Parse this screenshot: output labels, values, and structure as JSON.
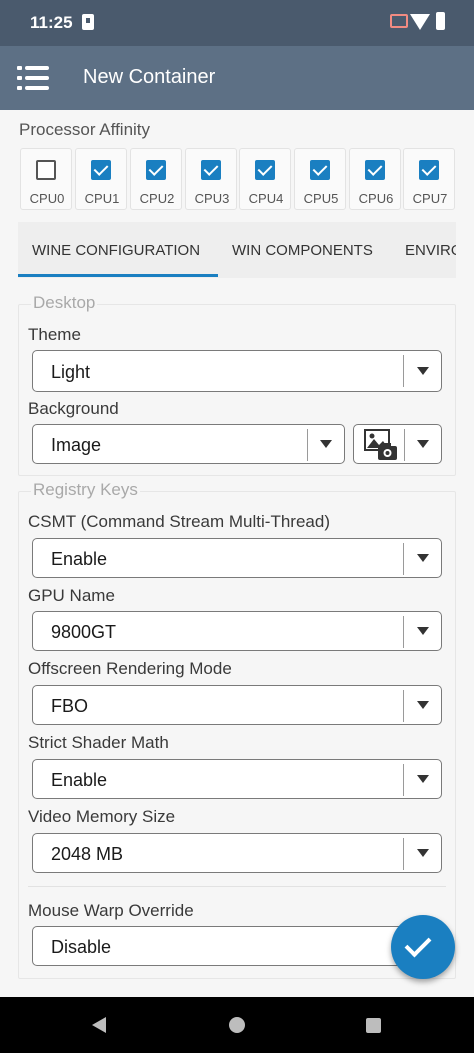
{
  "status_bar": {
    "time": "11:25"
  },
  "app_bar": {
    "title": "New Container"
  },
  "processor_affinity": {
    "label": "Processor Affinity",
    "cpus": [
      {
        "label": "CPU0",
        "checked": false
      },
      {
        "label": "CPU1",
        "checked": true
      },
      {
        "label": "CPU2",
        "checked": true
      },
      {
        "label": "CPU3",
        "checked": true
      },
      {
        "label": "CPU4",
        "checked": true
      },
      {
        "label": "CPU5",
        "checked": true
      },
      {
        "label": "CPU6",
        "checked": true
      },
      {
        "label": "CPU7",
        "checked": true
      }
    ]
  },
  "tabs": [
    {
      "label": "WINE CONFIGURATION",
      "active": true
    },
    {
      "label": "WIN COMPONENTS",
      "active": false
    },
    {
      "label": "ENVIRO",
      "active": false
    }
  ],
  "desktop": {
    "legend": "Desktop",
    "theme_label": "Theme",
    "theme_value": "Light",
    "background_label": "Background",
    "background_value": "Image"
  },
  "registry": {
    "legend": "Registry Keys",
    "csmt_label": "CSMT (Command Stream Multi-Thread)",
    "csmt_value": "Enable",
    "gpu_label": "GPU Name",
    "gpu_value": "9800GT",
    "offscreen_label": "Offscreen Rendering Mode",
    "offscreen_value": "FBO",
    "shader_label": "Strict Shader Math",
    "shader_value": "Enable",
    "vram_label": "Video Memory Size",
    "vram_value": "2048 MB",
    "mouse_label": "Mouse Warp Override",
    "mouse_value": "Disable"
  },
  "colors": {
    "accent": "#1a7fc1",
    "app_bar": "#5d7085",
    "status_bar": "#4a5a6d"
  }
}
